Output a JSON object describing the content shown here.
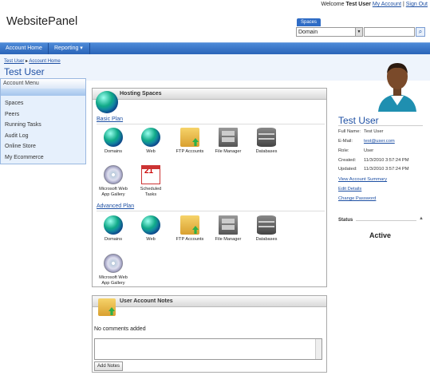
{
  "header": {
    "welcome": "Welcome",
    "user": "Test User",
    "my_account": "My Account",
    "sep": "|",
    "sign_out": "Sign Out",
    "logo": "WebsitePanel",
    "spaces_tab": "Spaces",
    "domain_select": "Domain"
  },
  "nav": {
    "items": [
      {
        "label": "Account Home"
      },
      {
        "label": "Reporting ▾"
      }
    ]
  },
  "breadcrumb": [
    "Test User",
    "Account Home"
  ],
  "breadcrumb_sep": "▸",
  "page_title": "Test User",
  "menu": {
    "title": "Account Menu",
    "items": [
      "Spaces",
      "Peers",
      "Running Tasks",
      "Audit Log",
      "Online Store",
      "My Ecommerce"
    ]
  },
  "hosting": {
    "title": "Hosting Spaces",
    "plans": [
      {
        "name": "Basic Plan",
        "resources": [
          "Domains",
          "Web",
          "FTP Accounts",
          "File Manager",
          "Databases",
          "Microsoft Web App Gallery",
          "Scheduled Tasks"
        ]
      },
      {
        "name": "Advanced Plan",
        "resources": [
          "Domains",
          "Web",
          "FTP Accounts",
          "File Manager",
          "Databases",
          "Microsoft Web App Gallery"
        ]
      }
    ]
  },
  "notes": {
    "title": "User Account Notes",
    "text": "No comments added",
    "button": "Add Notes"
  },
  "user": {
    "name": "Test User",
    "rows": [
      {
        "label": "Full Name:",
        "value": "Test User"
      },
      {
        "label": "E-Mail:",
        "value": "test@user.com"
      },
      {
        "label": "Role:",
        "value": "User"
      },
      {
        "label": "Created:",
        "value": "11/3/2010 3:57:24 PM"
      },
      {
        "label": "Updated:",
        "value": "11/3/2010 3:57:24 PM"
      }
    ],
    "links": [
      "View Account Summary",
      "Edit Details",
      "Change Password"
    ]
  },
  "status": {
    "title": "Status",
    "value": "Active"
  },
  "colors": {
    "accent": "#2f6cc5",
    "nav": "#3a78c9",
    "link": "#1d4fa3"
  }
}
